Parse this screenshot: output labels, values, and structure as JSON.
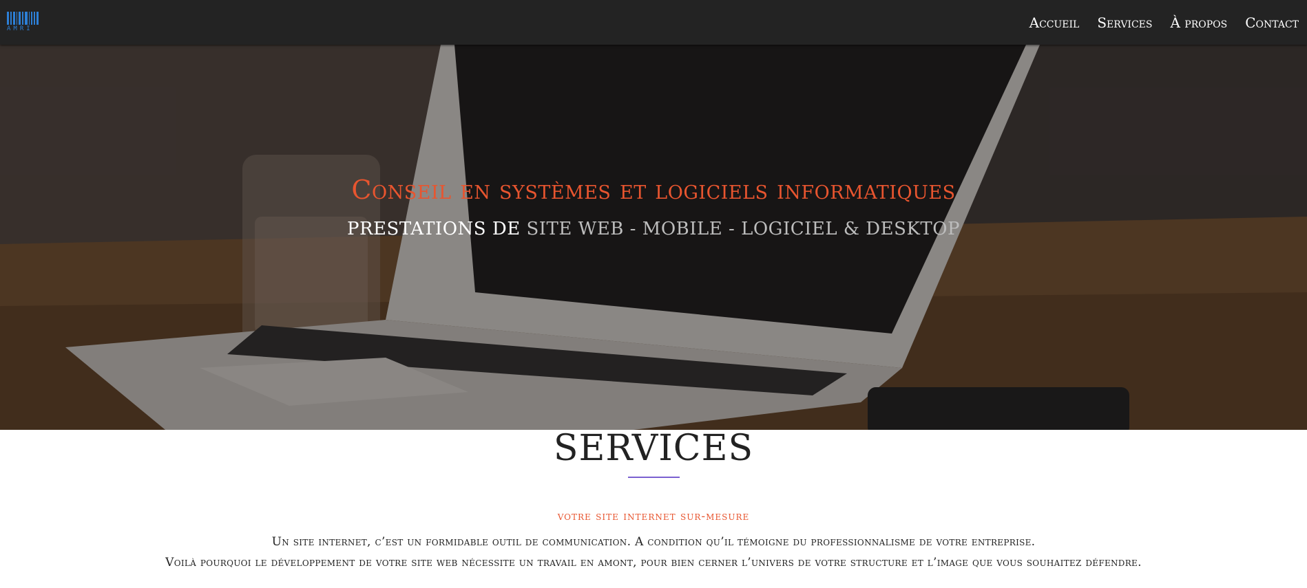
{
  "header": {
    "logo_text": "AMRI",
    "logo_color": "#2d7fd6",
    "nav": [
      {
        "label": "Accueil"
      },
      {
        "label": "Services"
      },
      {
        "label": "À propos"
      },
      {
        "label": "Contact"
      }
    ]
  },
  "hero": {
    "title": "Conseil en systèmes et logiciels informatiques",
    "subtitle_lead": "PRESTATIONS DE",
    "subtitle_rest": "SITE WEB - MOBILE - LOGICIEL & DESKTOP",
    "image": "laptop-on-desk-photo",
    "accent_color": "#e8552f"
  },
  "services": {
    "title": "SERVICES",
    "divider_color": "#7a5fd0",
    "subheading": "votre site internet sur-mesure",
    "paragraph_line1": "Un site internet, c’est un formidable outil de communication. A condition qu’il témoigne du professionnalisme de votre entreprise.",
    "paragraph_line2": "Voilà pourquoi le développement de votre site web nécessite un travail en amont, pour bien cerner l’univers de votre structure et l’image que vous souhaitez défendre."
  }
}
